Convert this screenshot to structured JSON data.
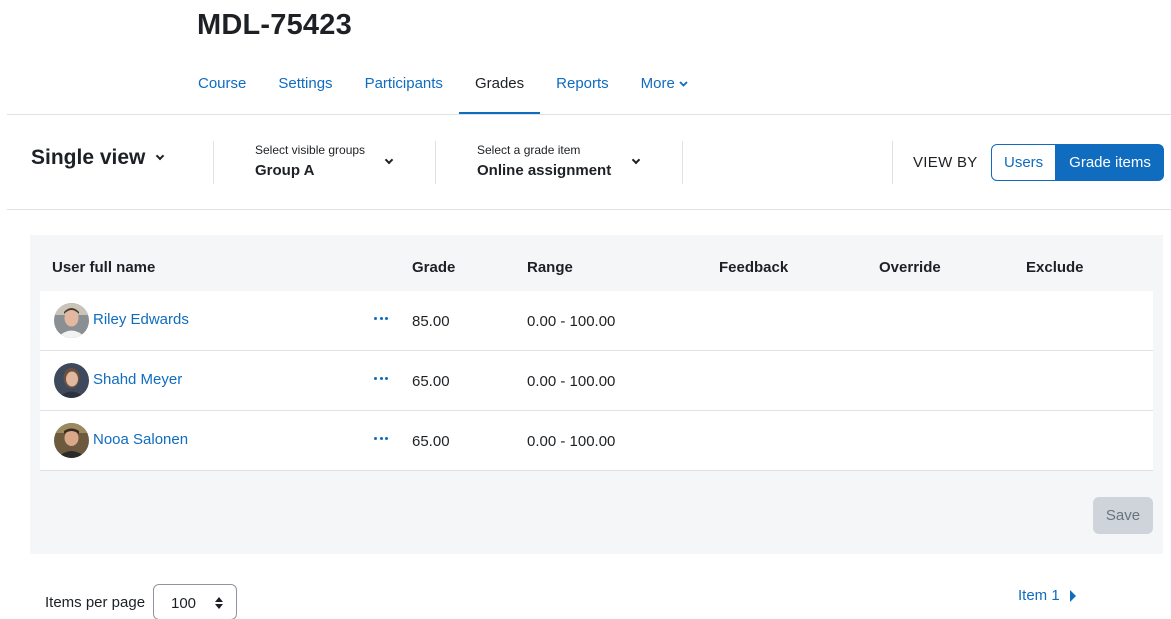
{
  "page": {
    "course_title": "MDL-75423"
  },
  "nav": {
    "items": [
      {
        "label": "Course"
      },
      {
        "label": "Settings"
      },
      {
        "label": "Participants"
      },
      {
        "label": "Grades"
      },
      {
        "label": "Reports"
      },
      {
        "label": "More"
      }
    ],
    "active": "Grades"
  },
  "toolbar": {
    "view_title": "Single view",
    "groups_label": "Select visible groups",
    "groups_value": "Group A",
    "grade_item_label": "Select a grade item",
    "grade_item_value": "Online assignment",
    "view_by_label": "VIEW BY",
    "view_by_users": "Users",
    "view_by_grade_items": "Grade items",
    "view_by_selected": "Grade items"
  },
  "table": {
    "columns": [
      "User full name",
      "Grade",
      "Range",
      "Feedback",
      "Override",
      "Exclude"
    ],
    "rows": [
      {
        "name": "Riley Edwards",
        "grade": "85.00",
        "range": "0.00 - 100.00",
        "avatar": "user-photo-icon"
      },
      {
        "name": "Shahd Meyer",
        "grade": "65.00",
        "range": "0.00 - 100.00",
        "avatar": "user-photo-icon"
      },
      {
        "name": "Nooa Salonen",
        "grade": "65.00",
        "range": "0.00 - 100.00",
        "avatar": "user-photo-icon"
      }
    ],
    "save_label": "Save"
  },
  "footer": {
    "per_page_label": "Items per page",
    "per_page_value": "100",
    "next_label": "Item 1"
  },
  "colors": {
    "accent": "#0f6cbf",
    "panel_bg": "#f5f6f8",
    "text": "#1d2125",
    "save_disabled_bg": "#ced4da"
  }
}
